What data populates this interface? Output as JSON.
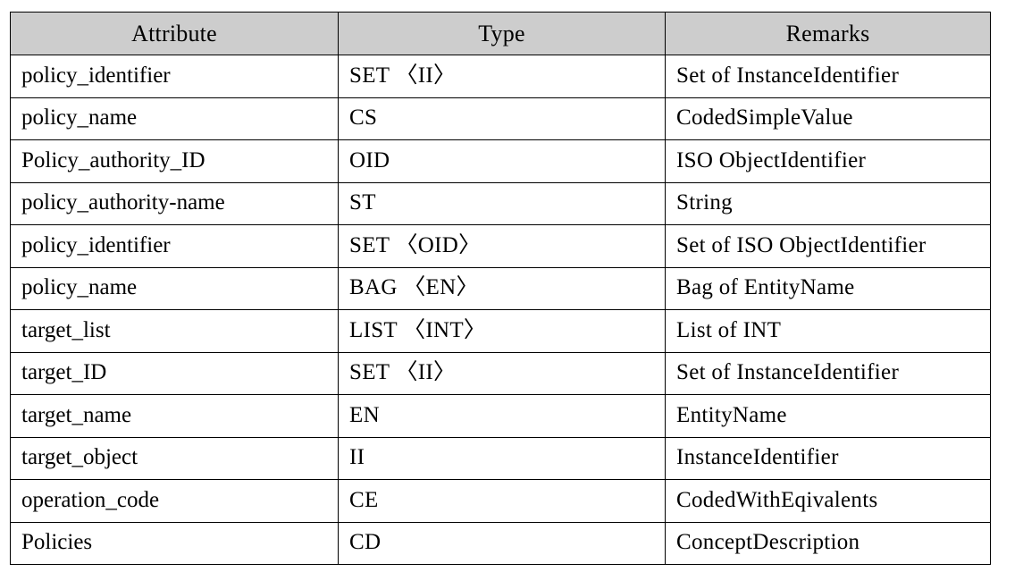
{
  "table": {
    "columns": [
      "Attribute",
      "Type",
      "Remarks"
    ],
    "rows": [
      {
        "attribute": "policy_identifier",
        "type": "SET 〈II〉",
        "remarks": "Set of InstanceIdentifier"
      },
      {
        "attribute": "policy_name",
        "type": "CS",
        "remarks": "CodedSimpleValue"
      },
      {
        "attribute": "Policy_authority_ID",
        "type": "OID",
        "remarks": "ISO ObjectIdentifier"
      },
      {
        "attribute": "policy_authority-name",
        "type": "ST",
        "remarks": "String"
      },
      {
        "attribute": "policy_identifier",
        "type": "SET 〈OID〉",
        "remarks": "Set of ISO ObjectIdentifier"
      },
      {
        "attribute": "policy_name",
        "type": "BAG 〈EN〉",
        "remarks": "Bag of EntityName"
      },
      {
        "attribute": "target_list",
        "type": "LIST 〈INT〉",
        "remarks": "List of INT"
      },
      {
        "attribute": "target_ID",
        "type": "SET 〈II〉",
        "remarks": "Set of InstanceIdentifier"
      },
      {
        "attribute": "target_name",
        "type": "EN",
        "remarks": "EntityName"
      },
      {
        "attribute": "target_object",
        "type": "II",
        "remarks": "InstanceIdentifier"
      },
      {
        "attribute": "operation_code",
        "type": "CE",
        "remarks": "CodedWithEqivalents"
      },
      {
        "attribute": "Policies",
        "type": "CD",
        "remarks": "ConceptDescription"
      }
    ]
  },
  "style": {
    "header_background": "#cdcdcd",
    "border_color": "#000000",
    "text_color": "#000000",
    "page_background": "#ffffff"
  }
}
